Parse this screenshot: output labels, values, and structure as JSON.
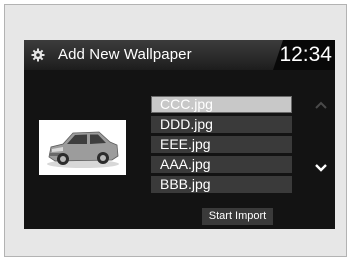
{
  "header": {
    "title": "Add New Wallpaper",
    "clock": "12:34",
    "icon": "gear-icon"
  },
  "preview": {
    "icon": "car-thumbnail-image"
  },
  "file_list": {
    "items": [
      {
        "label": "CCC.jpg",
        "selected": true
      },
      {
        "label": "DDD.jpg",
        "selected": false
      },
      {
        "label": "EEE.jpg",
        "selected": false
      },
      {
        "label": "AAA.jpg",
        "selected": false
      },
      {
        "label": "BBB.jpg",
        "selected": false
      }
    ],
    "scroll_up_icon": "chevron-up-icon",
    "scroll_down_icon": "chevron-down-icon"
  },
  "actions": {
    "start_import_label": "Start Import"
  },
  "colors": {
    "screen_bg": "#131313",
    "item_bg": "#3a3a3a",
    "selected_bg": "#c8c8c8",
    "text": "#ffffff"
  }
}
